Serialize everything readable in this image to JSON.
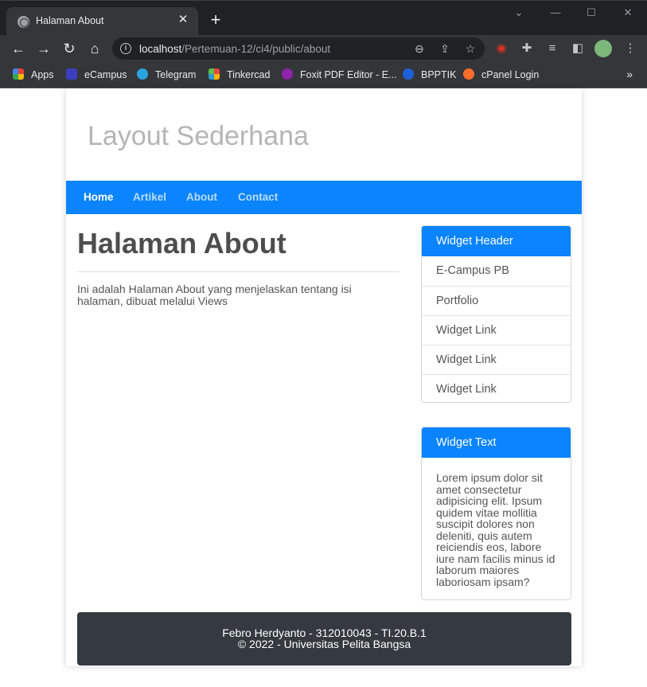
{
  "browser": {
    "tab_title": "Halaman About",
    "new_tab_symbol": "+",
    "url_host": "localhost",
    "url_path": "/Pertemuan-12/ci4/public/about",
    "window_controls": [
      "chevron-down",
      "minimize",
      "maximize",
      "close"
    ],
    "bookmarks": [
      {
        "label": "Apps",
        "icon": "apps-grid-icon",
        "color": "#ea4335"
      },
      {
        "label": "eCampus",
        "icon": "ecampus-icon",
        "color": "#3b3fbf"
      },
      {
        "label": "Telegram",
        "icon": "telegram-icon",
        "color": "#2aa3e0"
      },
      {
        "label": "Tinkercad",
        "icon": "tinkercad-icon",
        "color": "#e8453c"
      },
      {
        "label": "Foxit PDF Editor - E...",
        "icon": "foxit-icon",
        "color": "#8e24aa"
      },
      {
        "label": "BPPTIK",
        "icon": "bpptik-icon",
        "color": "#1e5fd8"
      },
      {
        "label": "cPanel Login",
        "icon": "cpanel-icon",
        "color": "#ff6c2c"
      }
    ],
    "bookmarks_more": "»"
  },
  "page": {
    "site_title": "Layout Sederhana",
    "nav": [
      {
        "label": "Home",
        "active": true
      },
      {
        "label": "Artikel",
        "active": false
      },
      {
        "label": "About",
        "active": false
      },
      {
        "label": "Contact",
        "active": false
      }
    ],
    "heading": "Halaman About",
    "body_text": "Ini adalah Halaman About yang menjelaskan tentang isi halaman, dibuat melalui Views",
    "widget_links": {
      "header": "Widget Header",
      "items": [
        "E-Campus PB",
        "Portfolio",
        "Widget Link",
        "Widget Link",
        "Widget Link"
      ]
    },
    "widget_text": {
      "header": "Widget Text",
      "body": "Lorem ipsum dolor sit amet consectetur adipisicing elit. Ipsum quidem vitae mollitia suscipit dolores non deleniti, quis autem reiciendis eos, labore iure nam facilis minus id laborum maiores laboriosam ipsam?"
    },
    "footer": {
      "line1": "Febro Herdyanto - 312010043 - TI.20.B.1",
      "line2": "© 2022 - Universitas Pelita Bangsa"
    },
    "colors": {
      "nav_bg": "#0a84ff",
      "footer_bg": "#343a40",
      "title_gray": "#b5b5b5"
    }
  }
}
